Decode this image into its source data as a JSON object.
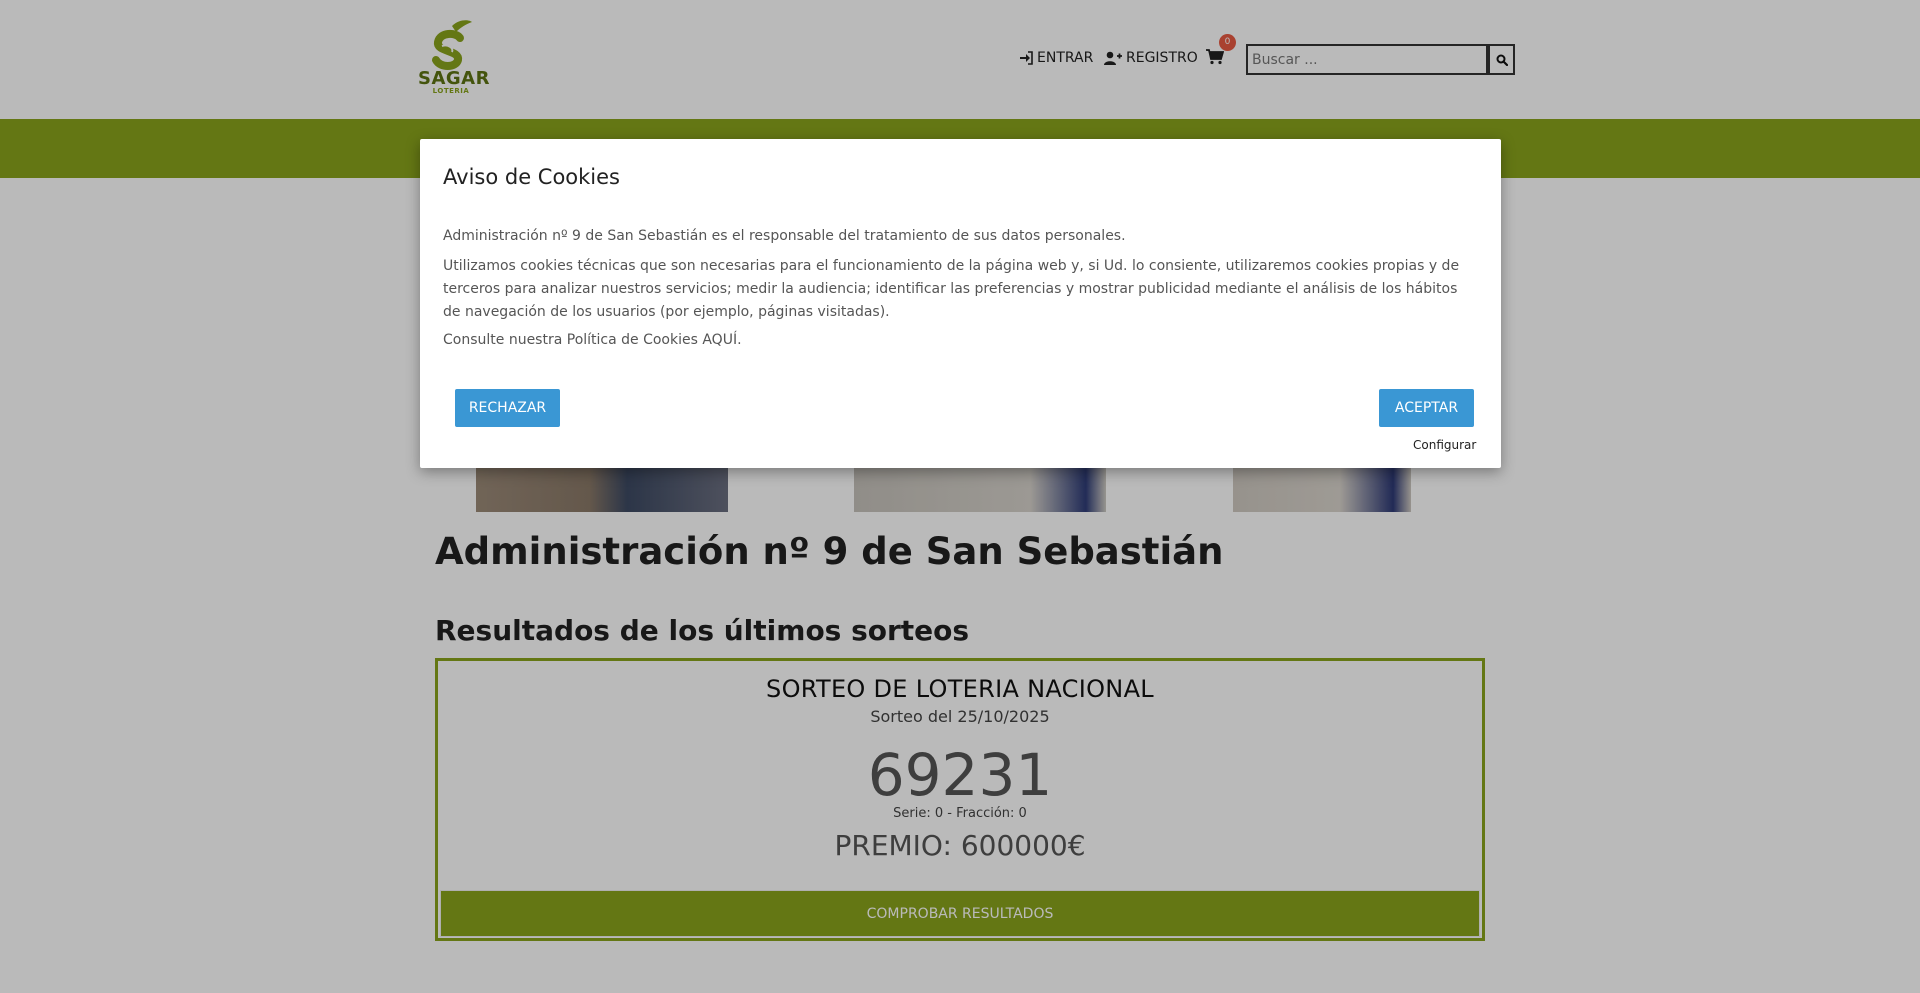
{
  "header": {
    "logo_text": "SAGAR",
    "logo_subtext": "LOTERIA",
    "login_label": "ENTRAR",
    "register_label": "REGISTRO",
    "cart_count": "0",
    "search_placeholder": "Buscar ..."
  },
  "icons": {
    "login": "sign-in-icon",
    "register": "user-plus-icon",
    "cart": "shopping-cart-icon",
    "search": "search-icon"
  },
  "main": {
    "page_title": "Administración nº 9 de San Sebastián",
    "section_title": "Resultados de los últimos sorteos",
    "result": {
      "heading": "SORTEO DE LOTERIA NACIONAL",
      "date": "Sorteo del 25/10/2025",
      "number": "69231",
      "serie": "Serie: 0 - Fracción: 0",
      "prize": "PREMIO: 600000€",
      "button_label": "COMPROBAR RESULTADOS"
    }
  },
  "cookie_modal": {
    "title": "Aviso de Cookies",
    "paragraph_1": "Administración nº 9 de San Sebastián es el responsable del tratamiento de sus datos personales.",
    "paragraph_2": "Utilizamos cookies técnicas que son necesarias para el funcionamiento de la página web y, si Ud. lo consiente, utilizaremos cookies propias y de terceros para analizar nuestros servicios; medir la audiencia; identificar las preferencias y mostrar publicidad mediante el análisis de los hábitos de navegación de los usuarios (por ejemplo, páginas visitadas).",
    "paragraph_3": "Consulte nuestra Política de Cookies AQUÍ.",
    "reject_label": "RECHAZAR",
    "accept_label": "ACEPTAR",
    "configure_label": "Configurar"
  },
  "colors": {
    "brand_green": "#8aa41c",
    "button_blue": "#3a97d4",
    "badge_red": "#e85a43"
  }
}
